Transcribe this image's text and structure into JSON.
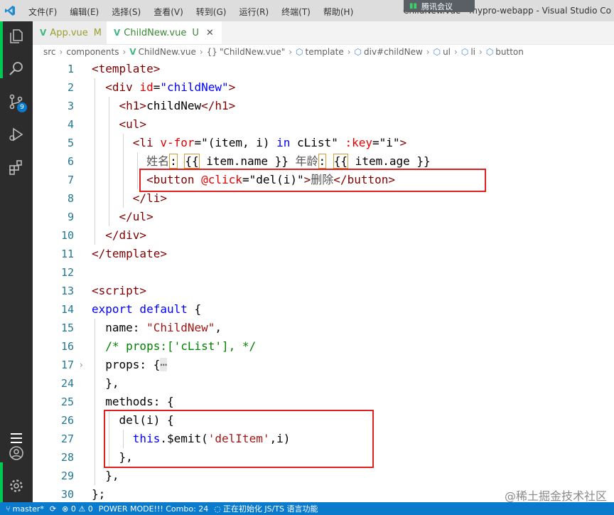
{
  "titlebar": {
    "menu": [
      "文件(F)",
      "编辑(E)",
      "选择(S)",
      "查看(V)",
      "转到(G)",
      "运行(R)",
      "终端(T)",
      "帮助(H)"
    ],
    "title": "ChildNew.vue - mypro-webapp - Visual Studio Co",
    "meeting": "腾讯会议"
  },
  "activitybar": {
    "icons": [
      "explorer-icon",
      "search-icon",
      "source-control-icon",
      "run-debug-icon",
      "extensions-icon",
      "outline-icon",
      "account-icon",
      "settings-gear-icon"
    ],
    "scm_badge": "9"
  },
  "tabs": [
    {
      "label": "App.vue",
      "flag": "M",
      "active": false
    },
    {
      "label": "ChildNew.vue",
      "flag": "U",
      "active": true
    }
  ],
  "breadcrumb": [
    "src",
    "components",
    "ChildNew.vue",
    "\"ChildNew.vue\"",
    "template",
    "div#childNew",
    "ul",
    "li",
    "button"
  ],
  "editor": {
    "line_numbers": [
      "1",
      "2",
      "3",
      "4",
      "5",
      "6",
      "7",
      "8",
      "9",
      "10",
      "11",
      "12",
      "13",
      "14",
      "15",
      "16",
      "17",
      "24",
      "25",
      "26",
      "27",
      "28",
      "29",
      "30"
    ]
  },
  "statusbar": {
    "branch": "master*",
    "problems": "⊗ 0 ⚠ 0",
    "power_mode": "POWER MODE!!! Combo: 24",
    "ts_status": "正在初始化 JS/TS 语言功能"
  },
  "watermark": "@稀土掘金技术社区",
  "colors": {
    "activity_bg": "#2c2c2c",
    "status_bg": "#0a7acc",
    "accent_green": "#00c853",
    "highlight_red": "#e02020"
  }
}
